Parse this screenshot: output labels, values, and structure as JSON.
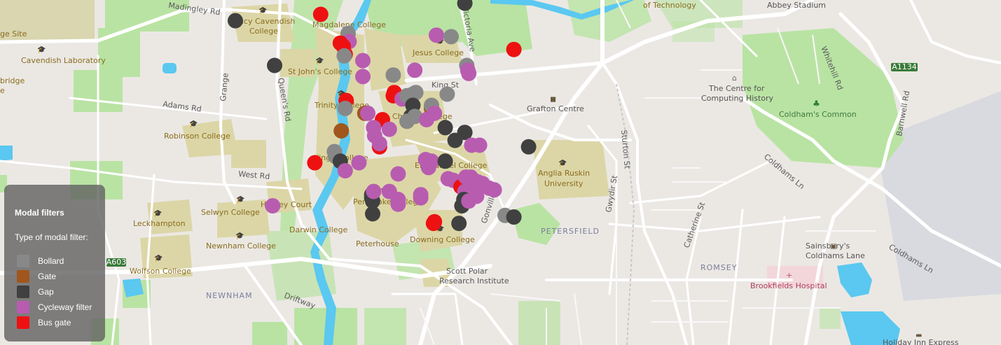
{
  "map": {
    "labels": {
      "madingley_rd": "Madingley Rd",
      "of_technology": "of Technology",
      "abbey_stadium": "Abbey Stadium",
      "ge_site": "ge Site",
      "lucy_cavendish": "Lucy Cavendish",
      "college_lc": "College",
      "magdalene": "Magdalene College",
      "victoria_ave": "Victoria Ave",
      "jesus": "Jesus College",
      "whitehill": "Whitehill Rd",
      "a1134": "A1134",
      "cavendish": "Cavendish Laboratory",
      "bridge": "bridge",
      "e_frag": "e",
      "st_johns": "St John's College",
      "kings_st": "King St",
      "centre_computing_1": "The Centre for",
      "centre_computing_2": "Computing History",
      "barnwell": "Barnwell Rd",
      "adams": "Adams Rd",
      "grange": "Grange",
      "queens": "Queen's Rd",
      "trinity": "Trinity College",
      "christs": "Christ's College",
      "grafton": "Grafton Centre",
      "coldhams_common": "Coldham's Common",
      "robinson": "Robinson College",
      "sturton": "Sturton St",
      "kings_college": "King's College",
      "emmanuel": "Emmanuel College",
      "west_rd": "West Rd",
      "anglia1": "Anglia Ruskin",
      "anglia2": "University",
      "gwydir": "Gwydir St",
      "coldhams_ln": "Coldhams Ln",
      "selwyn": "Selwyn College",
      "harvey_court": "Harvey Court",
      "pembroke": "Pembroke College",
      "leckhampton": "Leckhampton",
      "darwin": "Darwin College",
      "gonville": "Gonville Pl",
      "petersfield": "PETERSFIELD",
      "catherine": "Catherine St",
      "newnham_college": "Newnham College",
      "peterhouse": "Peterhouse",
      "downing": "Downing College",
      "sainsburys1": "Sainsbury's",
      "sainsburys2": "Coldhams Lane",
      "coldhams_ln2": "Coldhams Ln",
      "a603": "A603",
      "wolfson": "Wolfson College",
      "scott_polar1": "Scott Polar",
      "scott_polar2": "Research Institute",
      "romsey": "ROMSEY",
      "brookfields": "Brookfields Hospital",
      "newnham": "NEWNHAM",
      "driftway": "Driftway",
      "holiday_inn": "Holiday Inn Express"
    },
    "markers": [
      {
        "type": "bus_gate",
        "lat": 52.2128,
        "lon": 0.1139
      },
      {
        "type": "gap",
        "lat": 52.2124,
        "lon": 0.1052
      },
      {
        "type": "gap",
        "lat": 52.2096,
        "lon": 0.1092
      },
      {
        "type": "bollard",
        "lat": 52.2116,
        "lon": 0.1167
      },
      {
        "type": "cycleway",
        "lat": 52.2111,
        "lon": 0.1168
      },
      {
        "type": "bus_gate",
        "lat": 52.211,
        "lon": 0.1159
      },
      {
        "type": "bus_gate",
        "lat": 52.2108,
        "lon": 0.1162
      },
      {
        "type": "bus_gate",
        "lat": 52.2103,
        "lon": 0.1164
      },
      {
        "type": "bollard",
        "lat": 52.2102,
        "lon": 0.1163
      },
      {
        "type": "cycleway",
        "lat": 52.2099,
        "lon": 0.1182
      },
      {
        "type": "cycleway",
        "lat": 52.2089,
        "lon": 0.1182
      },
      {
        "type": "bollard",
        "lat": 52.209,
        "lon": 0.1213
      },
      {
        "type": "cycleway",
        "lat": 52.2093,
        "lon": 0.1235
      },
      {
        "type": "cycleway",
        "lat": 52.2115,
        "lon": 0.1257
      },
      {
        "type": "bollard",
        "lat": 52.2114,
        "lon": 0.1272
      },
      {
        "type": "gap",
        "lat": 52.2135,
        "lon": 0.1286
      },
      {
        "type": "bus_gate",
        "lat": 52.2106,
        "lon": 0.1336
      },
      {
        "type": "bollard",
        "lat": 52.2096,
        "lon": 0.1288
      },
      {
        "type": "cycleway",
        "lat": 52.2093,
        "lon": 0.1289
      },
      {
        "type": "cycleway",
        "lat": 52.2091,
        "lon": 0.129
      },
      {
        "type": "bus_gate",
        "lat": 52.2079,
        "lon": 0.1214
      },
      {
        "type": "bus_gate",
        "lat": 52.2077,
        "lon": 0.1213
      },
      {
        "type": "cycleway",
        "lat": 52.2075,
        "lon": 0.1222
      },
      {
        "type": "bollard",
        "lat": 52.2077,
        "lon": 0.1227
      },
      {
        "type": "bollard",
        "lat": 52.2078,
        "lon": 0.1233
      },
      {
        "type": "bollard",
        "lat": 52.2079,
        "lon": 0.1236
      },
      {
        "type": "bollard",
        "lat": 52.2077,
        "lon": 0.123
      },
      {
        "type": "gap",
        "lat": 52.2071,
        "lon": 0.1233
      },
      {
        "type": "gap",
        "lat": 52.2064,
        "lon": 0.1231
      },
      {
        "type": "bollard",
        "lat": 52.2061,
        "lon": 0.1227
      },
      {
        "type": "bollard",
        "lat": 52.2064,
        "lon": 0.1235
      },
      {
        "type": "gate",
        "lat": 52.2069,
        "lon": 0.1252
      },
      {
        "type": "bollard",
        "lat": 52.2071,
        "lon": 0.1252
      },
      {
        "type": "cycleway",
        "lat": 52.2066,
        "lon": 0.1255
      },
      {
        "type": "cycleway",
        "lat": 52.2062,
        "lon": 0.1247
      },
      {
        "type": "bollard",
        "lat": 52.2078,
        "lon": 0.1268
      },
      {
        "type": "gap",
        "lat": 52.2057,
        "lon": 0.1266
      },
      {
        "type": "gap",
        "lat": 52.2054,
        "lon": 0.1286
      },
      {
        "type": "bus_gate",
        "lat": 52.2074,
        "lon": 0.1165
      },
      {
        "type": "bollard",
        "lat": 52.2069,
        "lon": 0.1164
      },
      {
        "type": "gate",
        "lat": 52.2066,
        "lon": 0.1184
      },
      {
        "type": "cycleway",
        "lat": 52.2066,
        "lon": 0.1187
      },
      {
        "type": "bus_gate",
        "lat": 52.2062,
        "lon": 0.1202
      },
      {
        "type": "cycleway",
        "lat": 52.2057,
        "lon": 0.1193
      },
      {
        "type": "cycleway",
        "lat": 52.2052,
        "lon": 0.1194
      },
      {
        "type": "cycleway",
        "lat": 52.2056,
        "lon": 0.1209
      },
      {
        "type": "gate",
        "lat": 52.2055,
        "lon": 0.116
      },
      {
        "type": "bus_gate",
        "lat": 52.2045,
        "lon": 0.1199
      },
      {
        "type": "cycleway",
        "lat": 52.2047,
        "lon": 0.1199
      },
      {
        "type": "bollard",
        "lat": 52.2042,
        "lon": 0.1153
      },
      {
        "type": "bollard",
        "lat": 52.2039,
        "lon": 0.1154
      },
      {
        "type": "gap",
        "lat": 52.2036,
        "lon": 0.1159
      },
      {
        "type": "bus_gate",
        "lat": 52.2035,
        "lon": 0.1133
      },
      {
        "type": "cycleway",
        "lat": 52.2035,
        "lon": 0.1178
      },
      {
        "type": "cycleway",
        "lat": 52.203,
        "lon": 0.1164
      },
      {
        "type": "cycleway",
        "lat": 52.2028,
        "lon": 0.1218
      },
      {
        "type": "cycleway",
        "lat": 52.2037,
        "lon": 0.1246
      },
      {
        "type": "cycleway",
        "lat": 52.2036,
        "lon": 0.1252
      },
      {
        "type": "cycleway",
        "lat": 52.2032,
        "lon": 0.1249
      },
      {
        "type": "gap",
        "lat": 52.2036,
        "lon": 0.1266
      },
      {
        "type": "gap",
        "lat": 52.2049,
        "lon": 0.1276
      },
      {
        "type": "cycleway",
        "lat": 52.2046,
        "lon": 0.1293
      },
      {
        "type": "cycleway",
        "lat": 52.2046,
        "lon": 0.1301
      },
      {
        "type": "gap",
        "lat": 52.2045,
        "lon": 0.1351
      },
      {
        "type": "cycleway",
        "lat": 52.2025,
        "lon": 0.1269
      },
      {
        "type": "cycleway",
        "lat": 52.2024,
        "lon": 0.1274
      },
      {
        "type": "bus_gate",
        "lat": 52.202,
        "lon": 0.1282
      },
      {
        "type": "bus_gate",
        "lat": 52.2019,
        "lon": 0.1284
      },
      {
        "type": "cycleway",
        "lat": 52.2026,
        "lon": 0.1287
      },
      {
        "type": "cycleway",
        "lat": 52.2026,
        "lon": 0.1292
      },
      {
        "type": "cycleway",
        "lat": 52.2024,
        "lon": 0.1295
      },
      {
        "type": "cycleway",
        "lat": 52.2023,
        "lon": 0.1299
      },
      {
        "type": "cycleway",
        "lat": 52.2022,
        "lon": 0.1304
      },
      {
        "type": "cycleway",
        "lat": 52.2017,
        "lon": 0.1286
      },
      {
        "type": "cycleway",
        "lat": 52.2016,
        "lon": 0.129
      },
      {
        "type": "cycleway",
        "lat": 52.2016,
        "lon": 0.1294
      },
      {
        "type": "cycleway",
        "lat": 52.2019,
        "lon": 0.1311
      },
      {
        "type": "cycleway",
        "lat": 52.2018,
        "lon": 0.1316
      },
      {
        "type": "cycleway",
        "lat": 52.2014,
        "lon": 0.1298
      },
      {
        "type": "gap",
        "lat": 52.2012,
        "lon": 0.1285
      },
      {
        "type": "gap",
        "lat": 52.2008,
        "lon": 0.1283
      },
      {
        "type": "cycleway",
        "lat": 52.2011,
        "lon": 0.129
      },
      {
        "type": "cycleway",
        "lat": 52.2015,
        "lon": 0.1241
      },
      {
        "type": "cycleway",
        "lat": 52.2013,
        "lon": 0.1241
      },
      {
        "type": "cycleway",
        "lat": 52.2017,
        "lon": 0.1209
      },
      {
        "type": "gap",
        "lat": 52.2015,
        "lon": 0.1191
      },
      {
        "type": "gap",
        "lat": 52.2013,
        "lon": 0.1191
      },
      {
        "type": "gap",
        "lat": 52.2011,
        "lon": 0.1192
      },
      {
        "type": "cycleway",
        "lat": 52.2012,
        "lon": 0.1218
      },
      {
        "type": "cycleway",
        "lat": 52.2009,
        "lon": 0.1218
      },
      {
        "type": "cycleway",
        "lat": 52.2017,
        "lon": 0.1193
      },
      {
        "type": "gap",
        "lat": 52.2003,
        "lon": 0.1192
      },
      {
        "type": "cycleway",
        "lat": 52.2008,
        "lon": 0.109
      },
      {
        "type": "bollard",
        "lat": 52.2002,
        "lon": 0.1327
      },
      {
        "type": "gap",
        "lat": 52.2001,
        "lon": 0.1336
      },
      {
        "type": "bus_gate",
        "lat": 52.1998,
        "lon": 0.1255
      },
      {
        "type": "bus_gate",
        "lat": 52.1997,
        "lon": 0.1254
      },
      {
        "type": "gap",
        "lat": 52.1997,
        "lon": 0.128
      }
    ]
  },
  "legend": {
    "title": "Modal filters",
    "subtitle": "Type of modal filter:",
    "items": [
      {
        "key": "bollard",
        "label": "Bollard",
        "color": "#888888"
      },
      {
        "key": "gate",
        "label": "Gate",
        "color": "#a0561c"
      },
      {
        "key": "gap",
        "label": "Gap",
        "color": "#404040"
      },
      {
        "key": "cycleway",
        "label": "Cycleway filter",
        "color": "#b85cb0"
      },
      {
        "key": "bus_gate",
        "label": "Bus gate",
        "color": "#ee1111"
      }
    ]
  }
}
